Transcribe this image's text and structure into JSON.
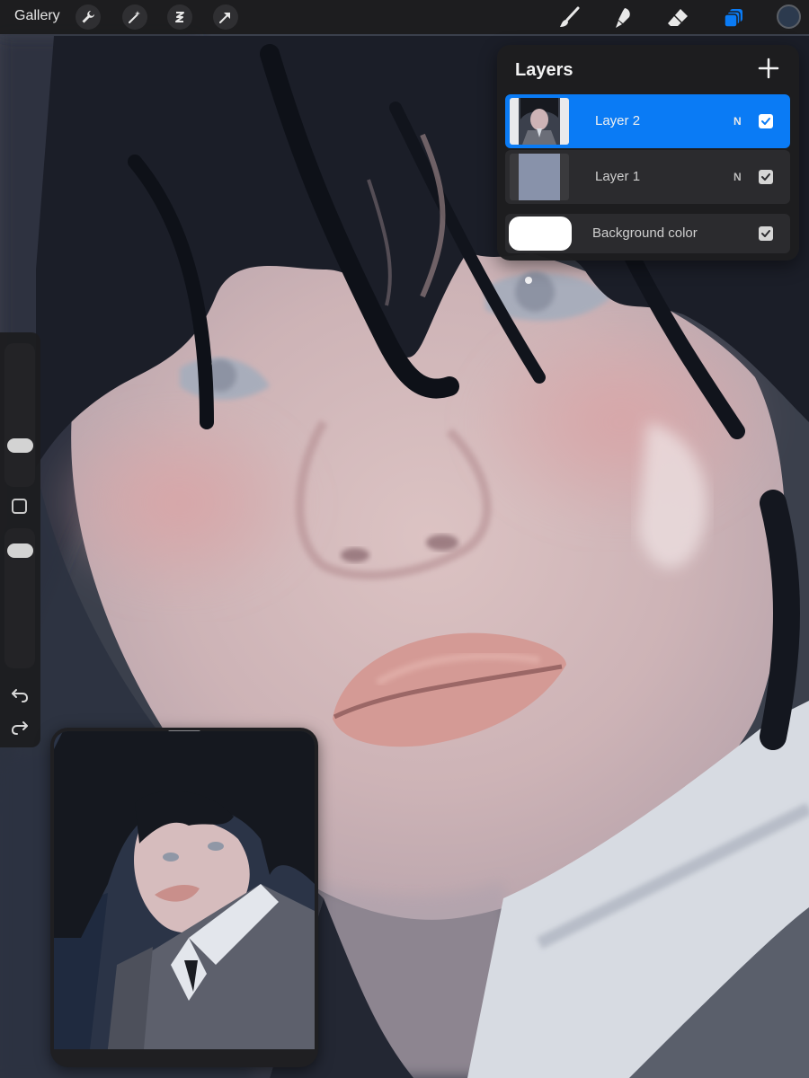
{
  "toolbar": {
    "gallery_label": "Gallery",
    "left_tools": [
      "wrench-icon",
      "magic-wand-icon",
      "selection-icon",
      "transform-arrow-icon"
    ],
    "right_tools": [
      "brush-icon",
      "smudge-icon",
      "eraser-icon",
      "layers-icon"
    ],
    "active_tool": "layers-icon",
    "current_color": "#2c3a4e",
    "accent_color": "#0a7bf5"
  },
  "sidebar": {
    "size_slider_level": 0.25,
    "opacity_slider_level": 0.9,
    "icons": [
      "modify-square-icon",
      "undo-icon",
      "redo-icon"
    ]
  },
  "layers_panel": {
    "title": "Layers",
    "layers": [
      {
        "name": "Layer 2",
        "blend_mode": "N",
        "visible": true,
        "selected": true
      },
      {
        "name": "Layer 1",
        "blend_mode": "N",
        "visible": true,
        "selected": false,
        "fill_color": "#8892aa"
      }
    ],
    "background": {
      "label": "Background color",
      "color": "#ffffff",
      "visible": true
    }
  },
  "reference_window": {
    "visible": true
  }
}
